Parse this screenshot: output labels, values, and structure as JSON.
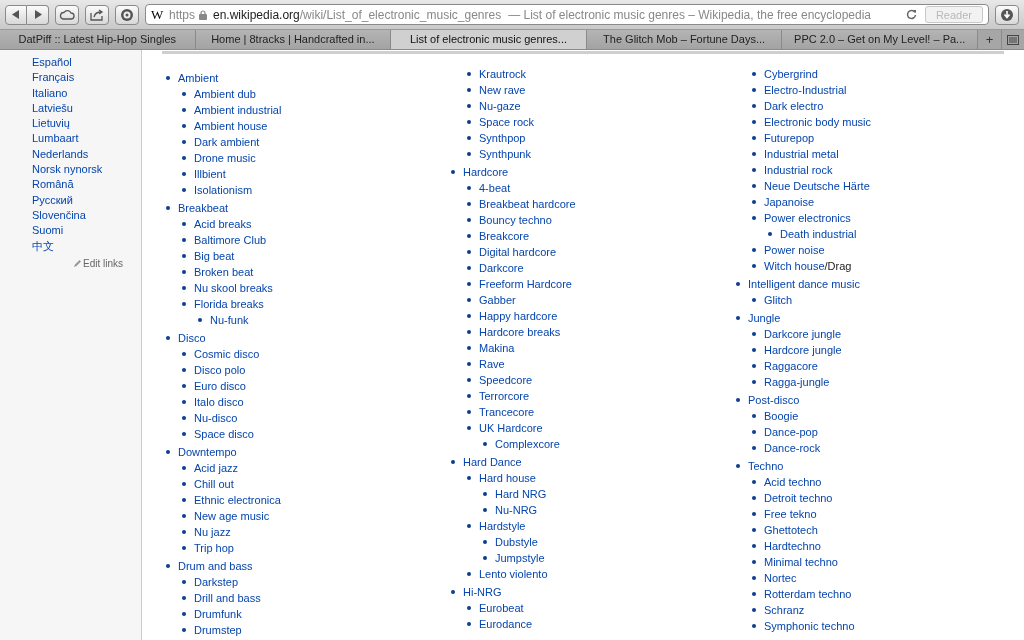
{
  "browser": {
    "address": {
      "favicon": "W",
      "scheme": "https",
      "host": "en.wikipedia.org",
      "path": "/wiki/List_of_electronic_music_genres",
      "page_title": "— List of electronic music genres – Wikipedia, the free encyclopedia"
    },
    "reader_button": {
      "label": "Reader",
      "disabled": true
    },
    "tabs": [
      {
        "label": "DatPiff :: Latest Hip-Hop Singles",
        "selected": false
      },
      {
        "label": "Home | 8tracks | Handcrafted in...",
        "selected": false
      },
      {
        "label": "List of electronic music genres...",
        "selected": true
      },
      {
        "label": "The Glitch Mob – Fortune Days...",
        "selected": false
      },
      {
        "label": "PPC 2.0 – Get on My Level! – Pa...",
        "selected": false
      }
    ],
    "new_tab_button": {
      "label": "+"
    }
  },
  "sidebar": {
    "languages": [
      "Español",
      "Français",
      "Italiano",
      "Latviešu",
      "Lietuvių",
      "Lumbaart",
      "Nederlands",
      "Norsk nynorsk",
      "Română",
      "Русский",
      "Slovenčina",
      "Suomi",
      "中文"
    ],
    "edit_links": "Edit links"
  },
  "columns": [
    {
      "items": [
        {
          "label": "Ambient",
          "children": [
            {
              "label": "Ambient dub"
            },
            {
              "label": "Ambient industrial"
            },
            {
              "label": "Ambient house"
            },
            {
              "label": "Dark ambient"
            },
            {
              "label": "Drone music"
            },
            {
              "label": "Illbient"
            },
            {
              "label": "Isolationism"
            }
          ]
        },
        {
          "label": "Breakbeat",
          "children": [
            {
              "label": "Acid breaks"
            },
            {
              "label": "Baltimore Club"
            },
            {
              "label": "Big beat"
            },
            {
              "label": "Broken beat"
            },
            {
              "label": "Nu skool breaks"
            },
            {
              "label": "Florida breaks",
              "children": [
                {
                  "label": "Nu-funk"
                }
              ]
            }
          ]
        },
        {
          "label": "Disco",
          "children": [
            {
              "label": "Cosmic disco"
            },
            {
              "label": "Disco polo"
            },
            {
              "label": "Euro disco"
            },
            {
              "label": "Italo disco"
            },
            {
              "label": "Nu-disco"
            },
            {
              "label": "Space disco"
            }
          ]
        },
        {
          "label": "Downtempo",
          "children": [
            {
              "label": "Acid jazz"
            },
            {
              "label": "Chill out"
            },
            {
              "label": "Ethnic electronica"
            },
            {
              "label": "New age music"
            },
            {
              "label": "Nu jazz"
            },
            {
              "label": "Trip hop"
            }
          ]
        },
        {
          "label": "Drum and bass",
          "children": [
            {
              "label": "Darkstep"
            },
            {
              "label": "Drill and bass"
            },
            {
              "label": "Drumfunk"
            },
            {
              "label": "Drumstep"
            }
          ]
        }
      ]
    },
    {
      "continued": [
        {
          "label": "Krautrock"
        },
        {
          "label": "New rave"
        },
        {
          "label": "Nu-gaze"
        },
        {
          "label": "Space rock"
        },
        {
          "label": "Synthpop"
        },
        {
          "label": "Synthpunk"
        }
      ],
      "items": [
        {
          "label": "Hardcore",
          "children": [
            {
              "label": "4-beat"
            },
            {
              "label": "Breakbeat hardcore"
            },
            {
              "label": "Bouncy techno"
            },
            {
              "label": "Breakcore"
            },
            {
              "label": "Digital hardcore"
            },
            {
              "label": "Darkcore"
            },
            {
              "label": "Freeform Hardcore"
            },
            {
              "label": "Gabber"
            },
            {
              "label": "Happy hardcore"
            },
            {
              "label": "Hardcore breaks"
            },
            {
              "label": "Makina"
            },
            {
              "label": "Rave"
            },
            {
              "label": "Speedcore"
            },
            {
              "label": "Terrorcore"
            },
            {
              "label": "Trancecore"
            },
            {
              "label": "UK Hardcore",
              "children": [
                {
                  "label": "Complexcore"
                }
              ]
            }
          ]
        },
        {
          "label": "Hard Dance",
          "children": [
            {
              "label": "Hard house",
              "children": [
                {
                  "label": "Hard NRG"
                },
                {
                  "label": "Nu-NRG"
                }
              ]
            },
            {
              "label": "Hardstyle",
              "children": [
                {
                  "label": "Dubstyle"
                },
                {
                  "label": "Jumpstyle"
                }
              ]
            },
            {
              "label": "Lento violento"
            }
          ]
        },
        {
          "label": "Hi-NRG",
          "children": [
            {
              "label": "Eurobeat"
            },
            {
              "label": "Eurodance"
            }
          ]
        }
      ]
    },
    {
      "continued": [
        {
          "label": "Cybergrind"
        },
        {
          "label": "Electro-Industrial"
        },
        {
          "label": "Dark electro"
        },
        {
          "label": "Electronic body music"
        },
        {
          "label": "Futurepop"
        },
        {
          "label": "Industrial metal"
        },
        {
          "label": "Industrial rock"
        },
        {
          "label": "Neue Deutsche Härte"
        },
        {
          "label": "Japanoise"
        },
        {
          "label": "Power electronics",
          "children": [
            {
              "label": "Death industrial"
            }
          ]
        },
        {
          "label": "Power noise"
        },
        {
          "label": "Witch house",
          "suffix": "/Drag"
        }
      ],
      "items": [
        {
          "label": "Intelligent dance music",
          "children": [
            {
              "label": "Glitch"
            }
          ]
        },
        {
          "label": "Jungle",
          "children": [
            {
              "label": "Darkcore jungle"
            },
            {
              "label": "Hardcore jungle"
            },
            {
              "label": "Raggacore"
            },
            {
              "label": "Ragga-jungle"
            }
          ]
        },
        {
          "label": "Post-disco",
          "children": [
            {
              "label": "Boogie"
            },
            {
              "label": "Dance-pop"
            },
            {
              "label": "Dance-rock"
            }
          ]
        },
        {
          "label": "Techno",
          "children": [
            {
              "label": "Acid techno"
            },
            {
              "label": "Detroit techno"
            },
            {
              "label": "Free tekno"
            },
            {
              "label": "Ghettotech"
            },
            {
              "label": "Hardtechno"
            },
            {
              "label": "Minimal techno"
            },
            {
              "label": "Nortec"
            },
            {
              "label": "Rotterdam techno"
            },
            {
              "label": "Schranz"
            },
            {
              "label": "Symphonic techno"
            }
          ]
        }
      ]
    }
  ]
}
